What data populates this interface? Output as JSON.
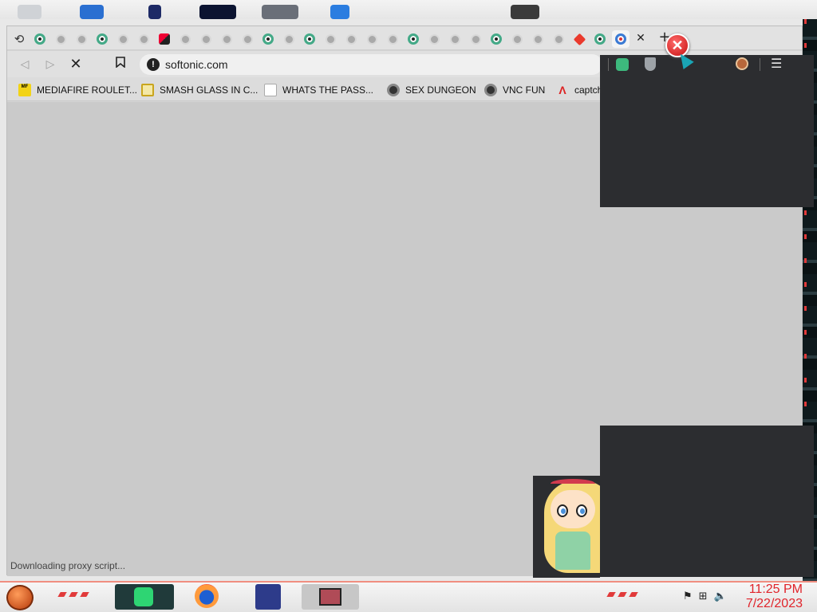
{
  "browser": {
    "tabs_count": 31,
    "address": "softonic.com",
    "status_text": "Downloading proxy script...",
    "close_tab_glyph": "✕",
    "new_tab_glyph": "+"
  },
  "bookmarks": [
    {
      "label": "MEDIAFIRE ROULET...",
      "icon": "mediafire-icon"
    },
    {
      "label": "SMASH GLASS IN C...",
      "icon": "smash-icon"
    },
    {
      "label": "WHATS THE PASS...",
      "icon": "lock-icon"
    },
    {
      "label": "SEX DUNGEON",
      "icon": "gear-icon"
    },
    {
      "label": "VNC FUN",
      "icon": "gear-icon"
    },
    {
      "label": "captcha solving sim...",
      "icon": "letter-a-icon"
    }
  ],
  "toolbar": {
    "back": "◁",
    "forward": "▷",
    "stop": "✕",
    "bookmark": "🔖"
  },
  "taskbar": {
    "time": "11:25 PM",
    "date": "7/22/2023",
    "apps": [
      "spotify-icon",
      "firefox-icon",
      "app-icon",
      "app-icon"
    ]
  },
  "colors": {
    "accent_red": "#e0232a",
    "dark_panel": "#2c2d30"
  }
}
